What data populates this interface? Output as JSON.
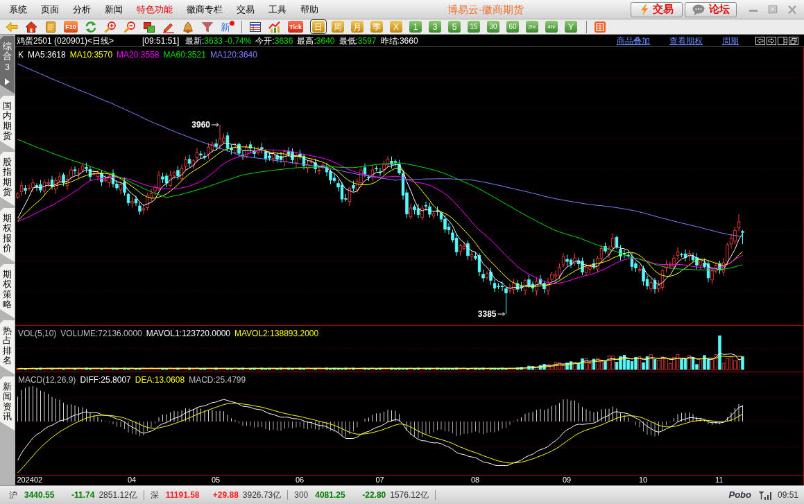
{
  "menu_bar": {
    "items": [
      {
        "label": "系统",
        "highlight": false
      },
      {
        "label": "页面",
        "highlight": false
      },
      {
        "label": "分析",
        "highlight": false
      },
      {
        "label": "新闻",
        "highlight": false
      },
      {
        "label": "特色功能",
        "highlight": true
      },
      {
        "label": "徽商专栏",
        "highlight": false
      },
      {
        "label": "交易",
        "highlight": false
      },
      {
        "label": "工具",
        "highlight": false
      },
      {
        "label": "帮助",
        "highlight": false
      }
    ],
    "title": "博易云-徽商期货",
    "buttons": [
      {
        "kind": "trade",
        "label": "交易"
      },
      {
        "kind": "forum",
        "label": "论坛"
      }
    ]
  },
  "toolbar": {
    "labeled_icons": [
      "F10",
      "新",
      "Tick"
    ],
    "periods": [
      {
        "label": "日",
        "kind": "daily",
        "selected": true
      },
      {
        "label": "周",
        "kind": "daily",
        "selected": false
      },
      {
        "label": "月",
        "kind": "daily",
        "selected": false
      },
      {
        "label": "季",
        "kind": "daily",
        "selected": false
      },
      {
        "label": "X",
        "kind": "daily",
        "selected": false
      },
      {
        "label": "1",
        "kind": "intraday",
        "selected": false
      },
      {
        "label": "3",
        "kind": "intraday",
        "selected": false
      },
      {
        "label": "5",
        "kind": "intraday",
        "selected": false
      },
      {
        "label": "15",
        "kind": "intraday",
        "selected": false
      },
      {
        "label": "30",
        "kind": "intraday",
        "selected": false
      },
      {
        "label": "60",
        "kind": "intraday",
        "selected": false
      },
      {
        "label": "2hr",
        "kind": "intraday",
        "selected": false
      },
      {
        "label": "4hr",
        "kind": "intraday",
        "selected": false
      },
      {
        "label": "Y",
        "kind": "intraday",
        "selected": false
      }
    ]
  },
  "sidebar": {
    "tabs": [
      {
        "label": "综合",
        "count": "3",
        "selected": true
      },
      {
        "label": "国内期货",
        "selected": false
      },
      {
        "label": "股指期货",
        "selected": false
      },
      {
        "label": "期权报价",
        "selected": false
      },
      {
        "label": "期权策略",
        "selected": false
      },
      {
        "label": "热占排名",
        "selected": false
      },
      {
        "label": "新闻资讯",
        "selected": false
      }
    ]
  },
  "quote_bar": {
    "symbol": "鸡蛋2501 (020901)<日线>",
    "time": "[09:51:51]",
    "fields": [
      {
        "label": "最新:",
        "value": "3633 -0.74%",
        "color": "#00e000"
      },
      {
        "label": "今开:",
        "value": "3636",
        "color": "#00e000"
      },
      {
        "label": "最高:",
        "value": "3640",
        "color": "#00e000"
      },
      {
        "label": "最低:",
        "value": "3597",
        "color": "#00e000"
      },
      {
        "label": "昨结:",
        "value": "3660",
        "color": "#ffffff"
      }
    ],
    "links": [
      "商品叠加",
      "查看期权",
      "周期"
    ]
  },
  "main_chart": {
    "legend": [
      {
        "text": "K",
        "color": "#ffffff"
      },
      {
        "text": "MA5:3618",
        "color": "#ffffff"
      },
      {
        "text": "MA10:3570",
        "color": "#ffff00"
      },
      {
        "text": "MA20:3558",
        "color": "#ff00ff"
      },
      {
        "text": "MA60:3521",
        "color": "#00e000"
      },
      {
        "text": "MA120:3640",
        "color": "#8080ff"
      }
    ],
    "high_label": "3960",
    "low_label": "3385"
  },
  "volume_chart": {
    "legend": [
      {
        "text": "VOL(5,10)",
        "color": "#c0c0c0"
      },
      {
        "text": "VOLUME:72136.0000",
        "color": "#c0c0c0"
      },
      {
        "text": "MAVOL1:123720.0000",
        "color": "#ffffff"
      },
      {
        "text": "MAVOL2:138893.2000",
        "color": "#ffff00"
      }
    ]
  },
  "macd_chart": {
    "legend": [
      {
        "text": "MACD(12,26,9)",
        "color": "#c0c0c0"
      },
      {
        "text": "DIFF:25.8007",
        "color": "#ffffff"
      },
      {
        "text": "DEA:13.0608",
        "color": "#ffff00"
      },
      {
        "text": "MACD:25.4799",
        "color": "#c0c0c0"
      }
    ]
  },
  "x_axis": {
    "labels": [
      "202402",
      "04",
      "05",
      "06",
      "07",
      "08",
      "09",
      "10",
      "11"
    ]
  },
  "status_bar": {
    "indices": [
      {
        "name": "沪",
        "price": "3440.55",
        "change": "-11.74",
        "amount": "2851.12亿",
        "color": "#008000"
      },
      {
        "name": "深",
        "price": "11191.58",
        "change": "+29.88",
        "amount": "3926.73亿",
        "color": "#ff2020"
      },
      {
        "name": "300",
        "price": "4081.25",
        "change": "-22.80",
        "amount": "1576.12亿",
        "color": "#008000"
      }
    ],
    "logo": "Pobo",
    "time": "09:51"
  }
}
